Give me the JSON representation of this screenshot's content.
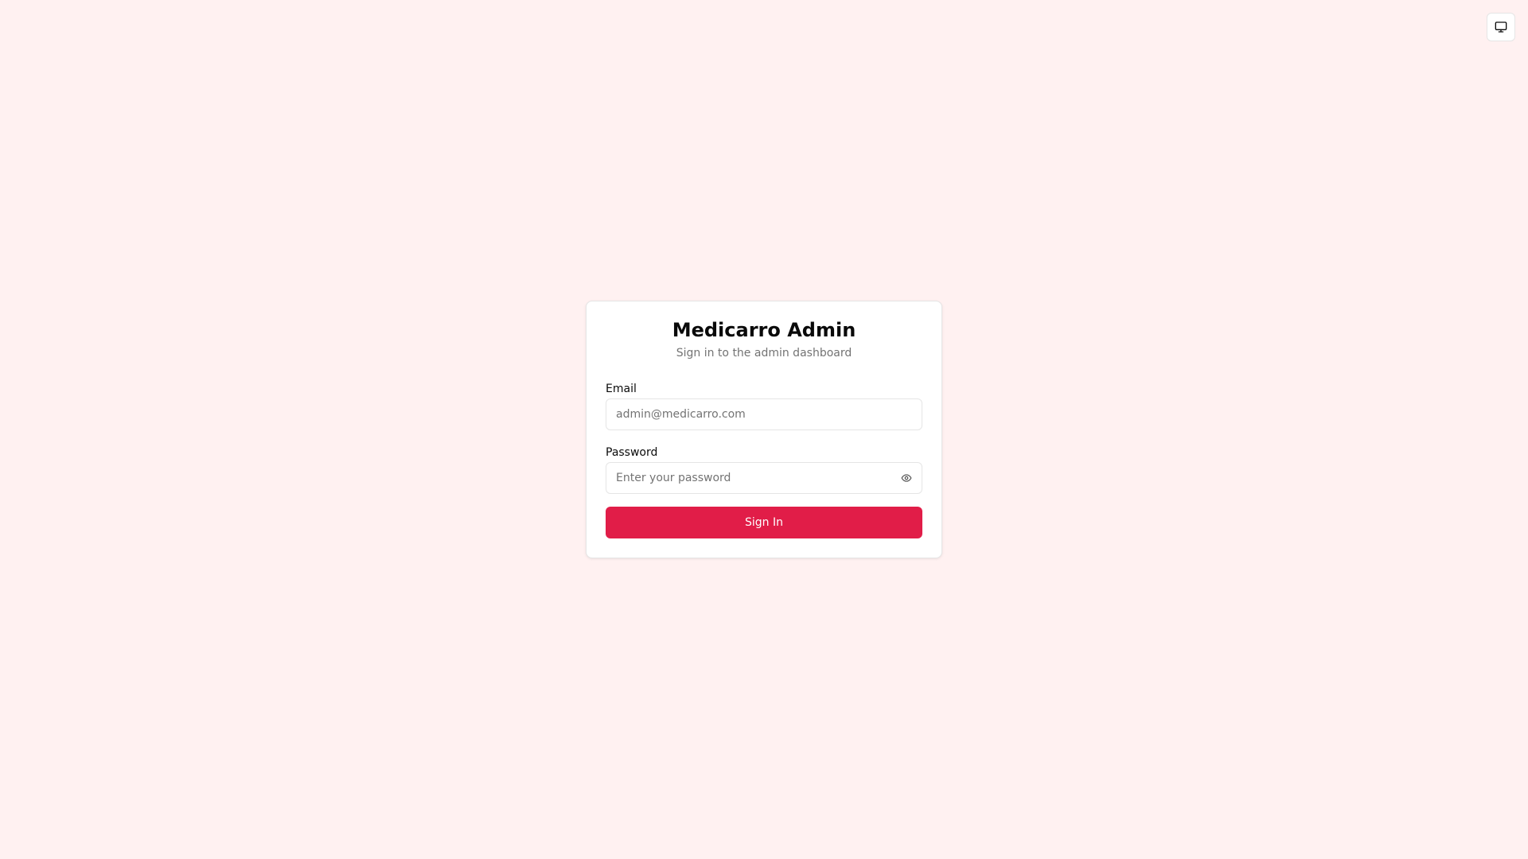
{
  "app": {
    "title": "Medicarro Admin",
    "subtitle": "Sign in to the admin dashboard"
  },
  "theme_toggle": {
    "icon": "monitor-icon"
  },
  "form": {
    "email_label": "Email",
    "email_placeholder": "admin@medicarro.com",
    "email_value": "",
    "password_label": "Password",
    "password_placeholder": "Enter your password",
    "password_value": "",
    "password_toggle_icon": "eye-icon",
    "submit_label": "Sign In"
  },
  "colors": {
    "background": "#fff1f1",
    "primary": "#e11d48",
    "card": "#ffffff",
    "muted_text": "#737373"
  }
}
